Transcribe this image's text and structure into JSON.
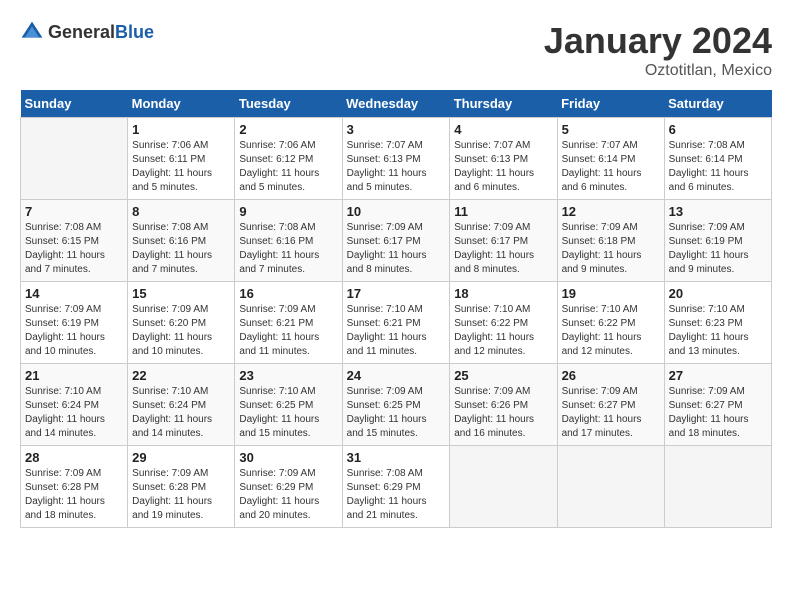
{
  "logo": {
    "general": "General",
    "blue": "Blue"
  },
  "title": "January 2024",
  "subtitle": "Oztotitlan, Mexico",
  "days_of_week": [
    "Sunday",
    "Monday",
    "Tuesday",
    "Wednesday",
    "Thursday",
    "Friday",
    "Saturday"
  ],
  "weeks": [
    [
      {
        "day": "",
        "sunrise": "",
        "sunset": "",
        "daylight": "",
        "empty": true
      },
      {
        "day": "1",
        "sunrise": "Sunrise: 7:06 AM",
        "sunset": "Sunset: 6:11 PM",
        "daylight": "Daylight: 11 hours and 5 minutes.",
        "empty": false
      },
      {
        "day": "2",
        "sunrise": "Sunrise: 7:06 AM",
        "sunset": "Sunset: 6:12 PM",
        "daylight": "Daylight: 11 hours and 5 minutes.",
        "empty": false
      },
      {
        "day": "3",
        "sunrise": "Sunrise: 7:07 AM",
        "sunset": "Sunset: 6:13 PM",
        "daylight": "Daylight: 11 hours and 5 minutes.",
        "empty": false
      },
      {
        "day": "4",
        "sunrise": "Sunrise: 7:07 AM",
        "sunset": "Sunset: 6:13 PM",
        "daylight": "Daylight: 11 hours and 6 minutes.",
        "empty": false
      },
      {
        "day": "5",
        "sunrise": "Sunrise: 7:07 AM",
        "sunset": "Sunset: 6:14 PM",
        "daylight": "Daylight: 11 hours and 6 minutes.",
        "empty": false
      },
      {
        "day": "6",
        "sunrise": "Sunrise: 7:08 AM",
        "sunset": "Sunset: 6:14 PM",
        "daylight": "Daylight: 11 hours and 6 minutes.",
        "empty": false
      }
    ],
    [
      {
        "day": "7",
        "sunrise": "Sunrise: 7:08 AM",
        "sunset": "Sunset: 6:15 PM",
        "daylight": "Daylight: 11 hours and 7 minutes.",
        "empty": false
      },
      {
        "day": "8",
        "sunrise": "Sunrise: 7:08 AM",
        "sunset": "Sunset: 6:16 PM",
        "daylight": "Daylight: 11 hours and 7 minutes.",
        "empty": false
      },
      {
        "day": "9",
        "sunrise": "Sunrise: 7:08 AM",
        "sunset": "Sunset: 6:16 PM",
        "daylight": "Daylight: 11 hours and 7 minutes.",
        "empty": false
      },
      {
        "day": "10",
        "sunrise": "Sunrise: 7:09 AM",
        "sunset": "Sunset: 6:17 PM",
        "daylight": "Daylight: 11 hours and 8 minutes.",
        "empty": false
      },
      {
        "day": "11",
        "sunrise": "Sunrise: 7:09 AM",
        "sunset": "Sunset: 6:17 PM",
        "daylight": "Daylight: 11 hours and 8 minutes.",
        "empty": false
      },
      {
        "day": "12",
        "sunrise": "Sunrise: 7:09 AM",
        "sunset": "Sunset: 6:18 PM",
        "daylight": "Daylight: 11 hours and 9 minutes.",
        "empty": false
      },
      {
        "day": "13",
        "sunrise": "Sunrise: 7:09 AM",
        "sunset": "Sunset: 6:19 PM",
        "daylight": "Daylight: 11 hours and 9 minutes.",
        "empty": false
      }
    ],
    [
      {
        "day": "14",
        "sunrise": "Sunrise: 7:09 AM",
        "sunset": "Sunset: 6:19 PM",
        "daylight": "Daylight: 11 hours and 10 minutes.",
        "empty": false
      },
      {
        "day": "15",
        "sunrise": "Sunrise: 7:09 AM",
        "sunset": "Sunset: 6:20 PM",
        "daylight": "Daylight: 11 hours and 10 minutes.",
        "empty": false
      },
      {
        "day": "16",
        "sunrise": "Sunrise: 7:09 AM",
        "sunset": "Sunset: 6:21 PM",
        "daylight": "Daylight: 11 hours and 11 minutes.",
        "empty": false
      },
      {
        "day": "17",
        "sunrise": "Sunrise: 7:10 AM",
        "sunset": "Sunset: 6:21 PM",
        "daylight": "Daylight: 11 hours and 11 minutes.",
        "empty": false
      },
      {
        "day": "18",
        "sunrise": "Sunrise: 7:10 AM",
        "sunset": "Sunset: 6:22 PM",
        "daylight": "Daylight: 11 hours and 12 minutes.",
        "empty": false
      },
      {
        "day": "19",
        "sunrise": "Sunrise: 7:10 AM",
        "sunset": "Sunset: 6:22 PM",
        "daylight": "Daylight: 11 hours and 12 minutes.",
        "empty": false
      },
      {
        "day": "20",
        "sunrise": "Sunrise: 7:10 AM",
        "sunset": "Sunset: 6:23 PM",
        "daylight": "Daylight: 11 hours and 13 minutes.",
        "empty": false
      }
    ],
    [
      {
        "day": "21",
        "sunrise": "Sunrise: 7:10 AM",
        "sunset": "Sunset: 6:24 PM",
        "daylight": "Daylight: 11 hours and 14 minutes.",
        "empty": false
      },
      {
        "day": "22",
        "sunrise": "Sunrise: 7:10 AM",
        "sunset": "Sunset: 6:24 PM",
        "daylight": "Daylight: 11 hours and 14 minutes.",
        "empty": false
      },
      {
        "day": "23",
        "sunrise": "Sunrise: 7:10 AM",
        "sunset": "Sunset: 6:25 PM",
        "daylight": "Daylight: 11 hours and 15 minutes.",
        "empty": false
      },
      {
        "day": "24",
        "sunrise": "Sunrise: 7:09 AM",
        "sunset": "Sunset: 6:25 PM",
        "daylight": "Daylight: 11 hours and 15 minutes.",
        "empty": false
      },
      {
        "day": "25",
        "sunrise": "Sunrise: 7:09 AM",
        "sunset": "Sunset: 6:26 PM",
        "daylight": "Daylight: 11 hours and 16 minutes.",
        "empty": false
      },
      {
        "day": "26",
        "sunrise": "Sunrise: 7:09 AM",
        "sunset": "Sunset: 6:27 PM",
        "daylight": "Daylight: 11 hours and 17 minutes.",
        "empty": false
      },
      {
        "day": "27",
        "sunrise": "Sunrise: 7:09 AM",
        "sunset": "Sunset: 6:27 PM",
        "daylight": "Daylight: 11 hours and 18 minutes.",
        "empty": false
      }
    ],
    [
      {
        "day": "28",
        "sunrise": "Sunrise: 7:09 AM",
        "sunset": "Sunset: 6:28 PM",
        "daylight": "Daylight: 11 hours and 18 minutes.",
        "empty": false
      },
      {
        "day": "29",
        "sunrise": "Sunrise: 7:09 AM",
        "sunset": "Sunset: 6:28 PM",
        "daylight": "Daylight: 11 hours and 19 minutes.",
        "empty": false
      },
      {
        "day": "30",
        "sunrise": "Sunrise: 7:09 AM",
        "sunset": "Sunset: 6:29 PM",
        "daylight": "Daylight: 11 hours and 20 minutes.",
        "empty": false
      },
      {
        "day": "31",
        "sunrise": "Sunrise: 7:08 AM",
        "sunset": "Sunset: 6:29 PM",
        "daylight": "Daylight: 11 hours and 21 minutes.",
        "empty": false
      },
      {
        "day": "",
        "sunrise": "",
        "sunset": "",
        "daylight": "",
        "empty": true
      },
      {
        "day": "",
        "sunrise": "",
        "sunset": "",
        "daylight": "",
        "empty": true
      },
      {
        "day": "",
        "sunrise": "",
        "sunset": "",
        "daylight": "",
        "empty": true
      }
    ]
  ]
}
